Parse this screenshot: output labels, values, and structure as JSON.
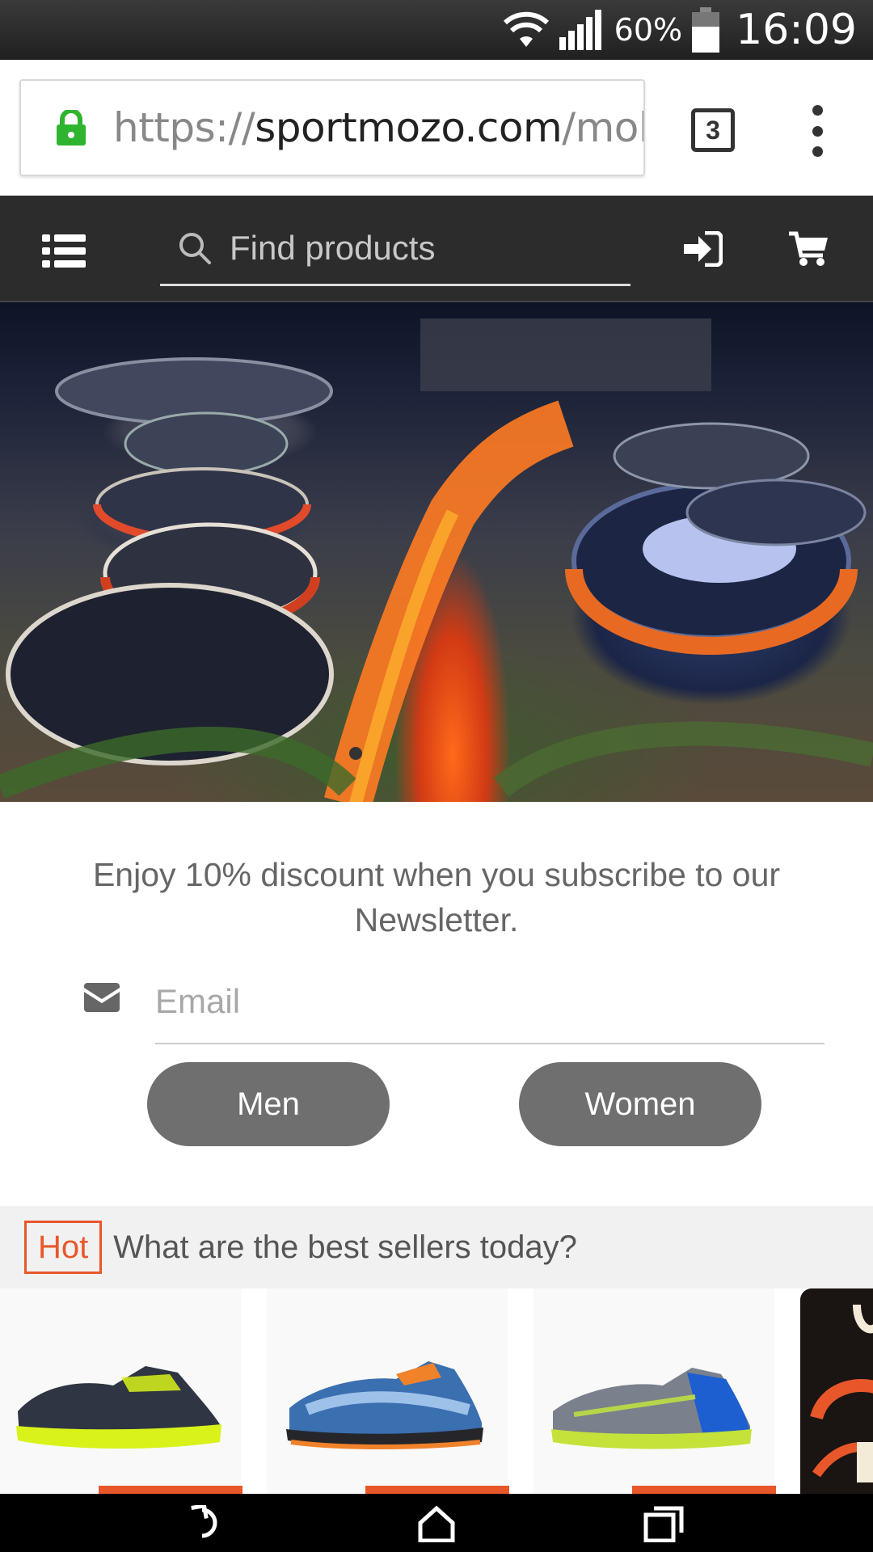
{
  "status_bar": {
    "battery_percent": "60%",
    "time": "16:09"
  },
  "browser": {
    "url_scheme": "https://",
    "url_host": "sportmozo.com",
    "url_path": "/mol",
    "tab_count": "3"
  },
  "header": {
    "search_placeholder": "Find products"
  },
  "newsletter": {
    "text": "Enjoy 10% discount when you subscribe to our Newsletter.",
    "email_placeholder": "Email",
    "men_label": "Men",
    "women_label": "Women"
  },
  "best_sellers": {
    "badge": "Hot",
    "title": "What are the best sellers today?",
    "products": [
      {
        "name": "black-yellow-running-shoe",
        "colors": [
          "#2f3542",
          "#d8f21a"
        ]
      },
      {
        "name": "blue-orange-trail-shoe",
        "colors": [
          "#3a6fb0",
          "#f0822a"
        ]
      },
      {
        "name": "grey-blue-running-shoe",
        "colors": [
          "#7a808c",
          "#1d5fd0"
        ]
      }
    ]
  },
  "colors": {
    "accent": "#e8572a",
    "header_bg": "#2c2c2c",
    "pill_bg": "#6f6f6f",
    "secure_green": "#2fb42f"
  }
}
